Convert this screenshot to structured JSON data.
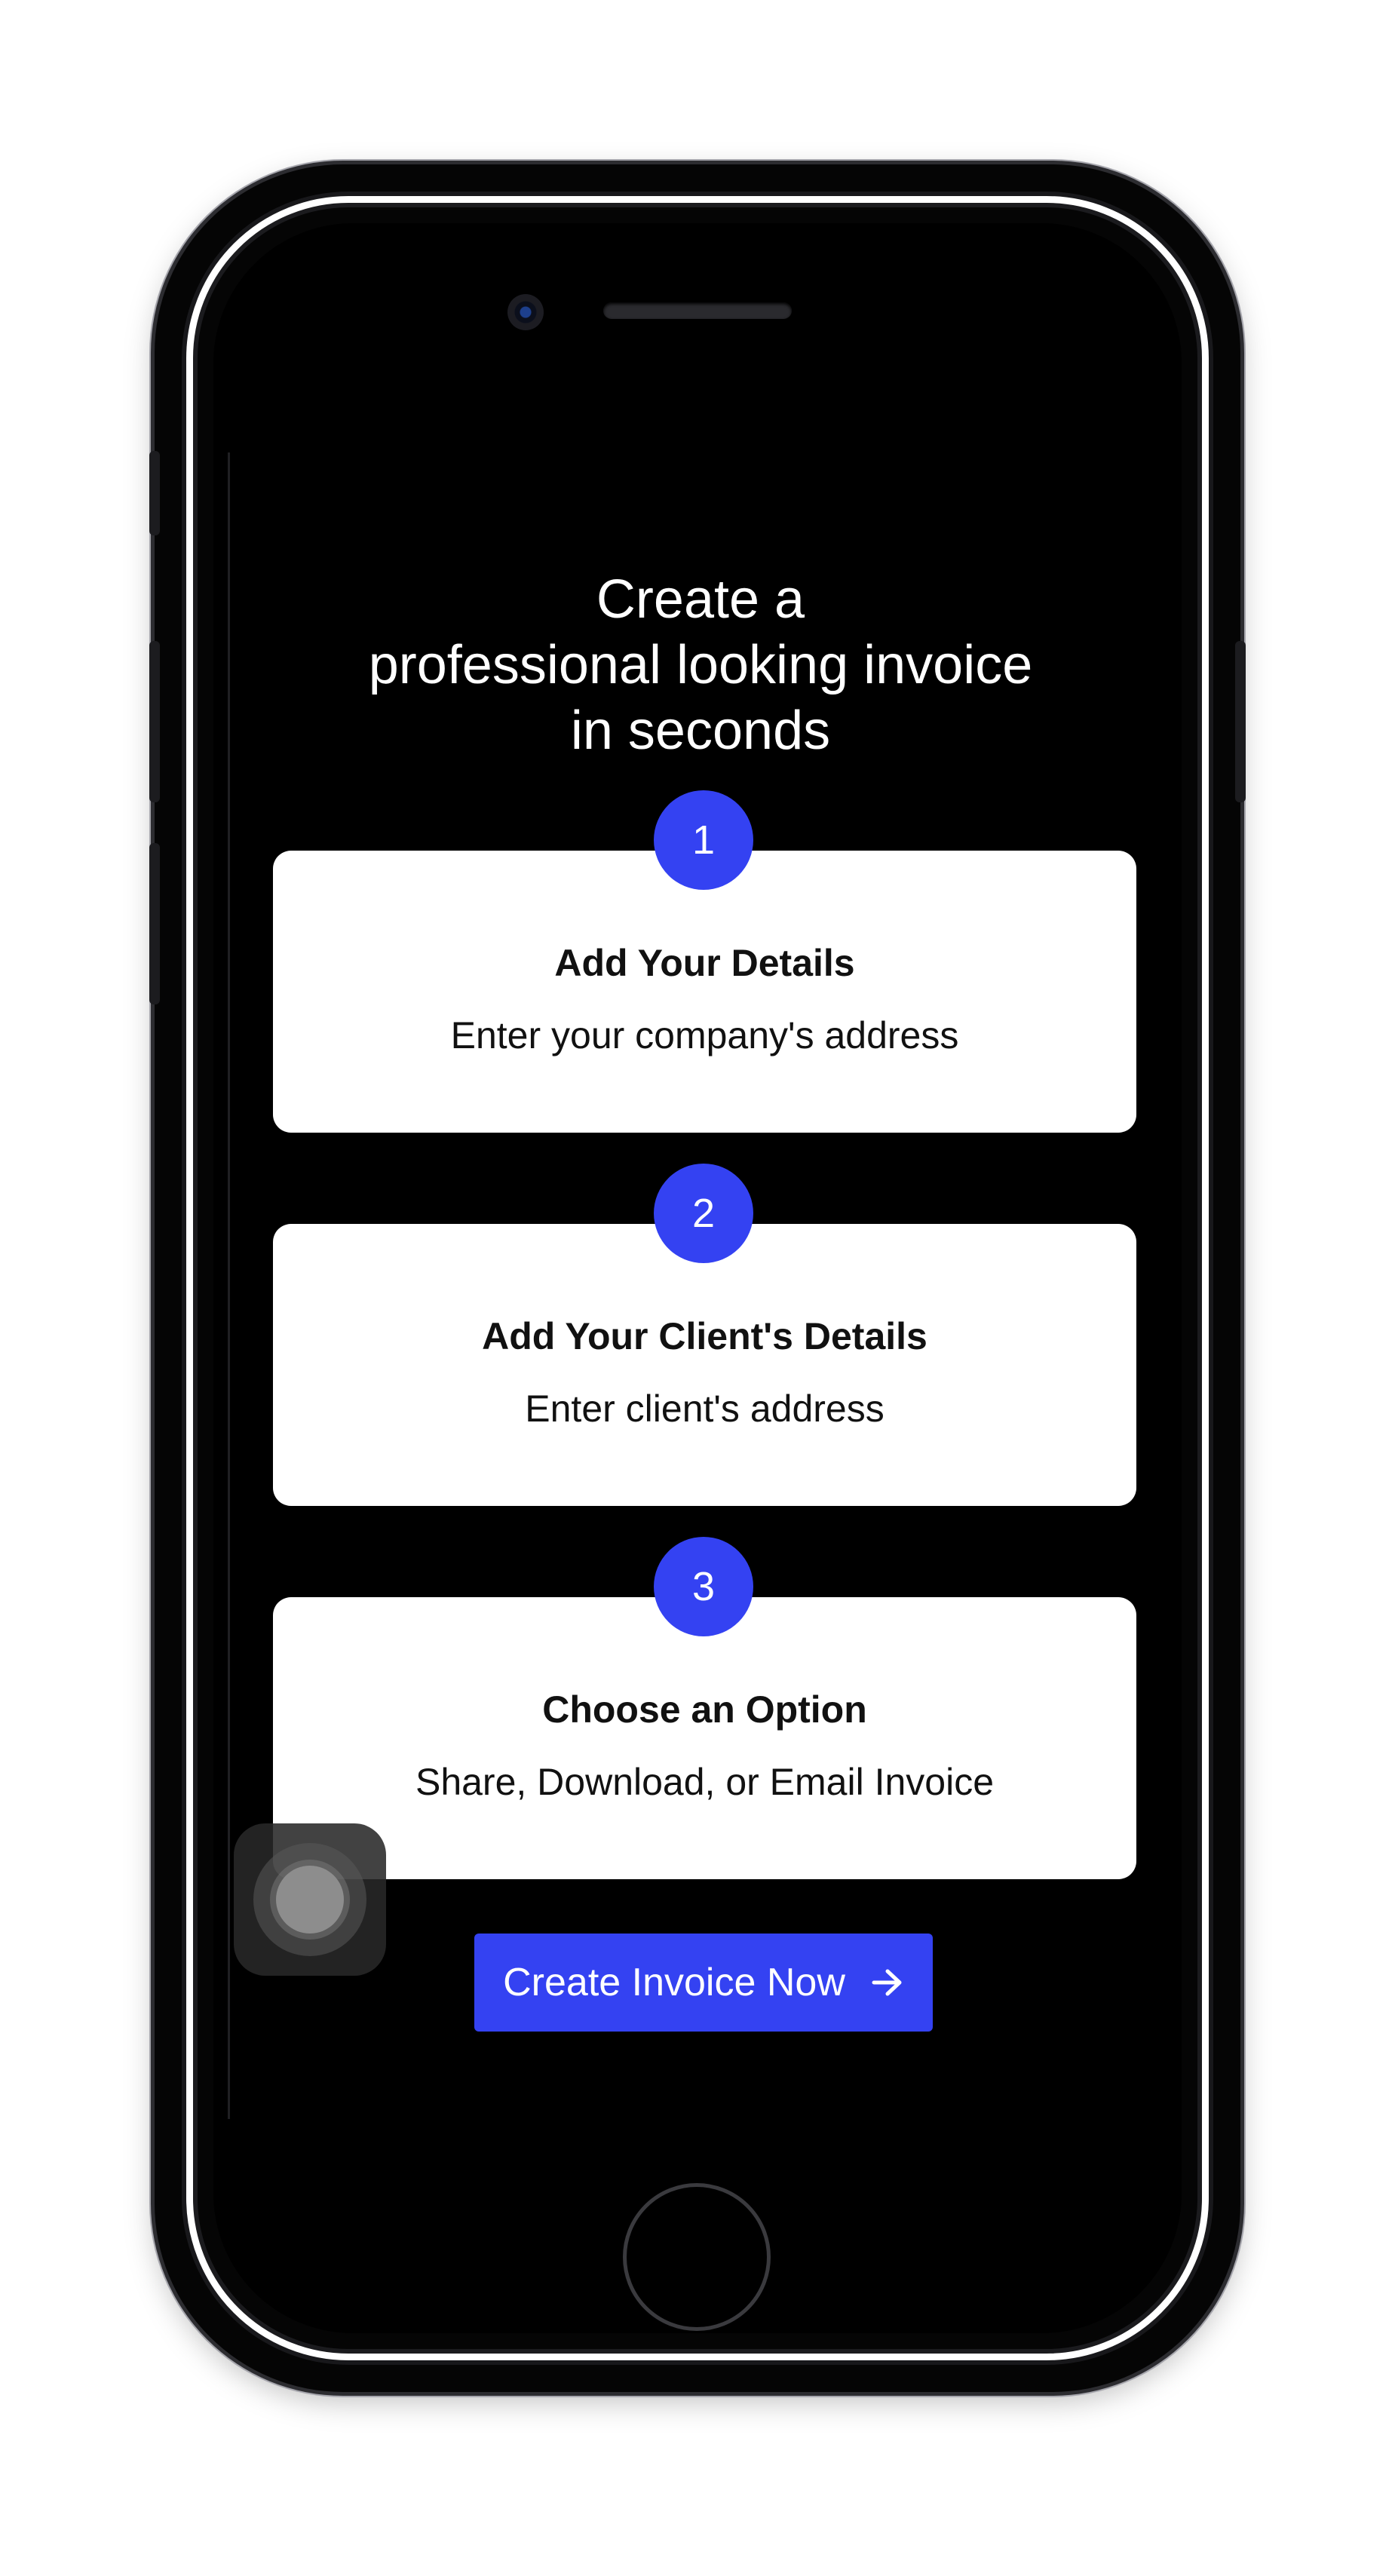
{
  "headline": {
    "line1": "Create a",
    "line2": "professional looking invoice",
    "line3": "in seconds"
  },
  "steps": [
    {
      "number": "1",
      "title": "Add Your Details",
      "description": "Enter your company's address"
    },
    {
      "number": "2",
      "title": "Add Your Client's Details",
      "description": "Enter client's address"
    },
    {
      "number": "3",
      "title": "Choose an Option",
      "description": "Share, Download, or Email Invoice"
    }
  ],
  "cta": {
    "label": "Create Invoice Now",
    "icon": "arrow-right-icon"
  },
  "colors": {
    "accent": "#3442f2",
    "screen_bg": "#000000",
    "card_bg": "#ffffff"
  }
}
